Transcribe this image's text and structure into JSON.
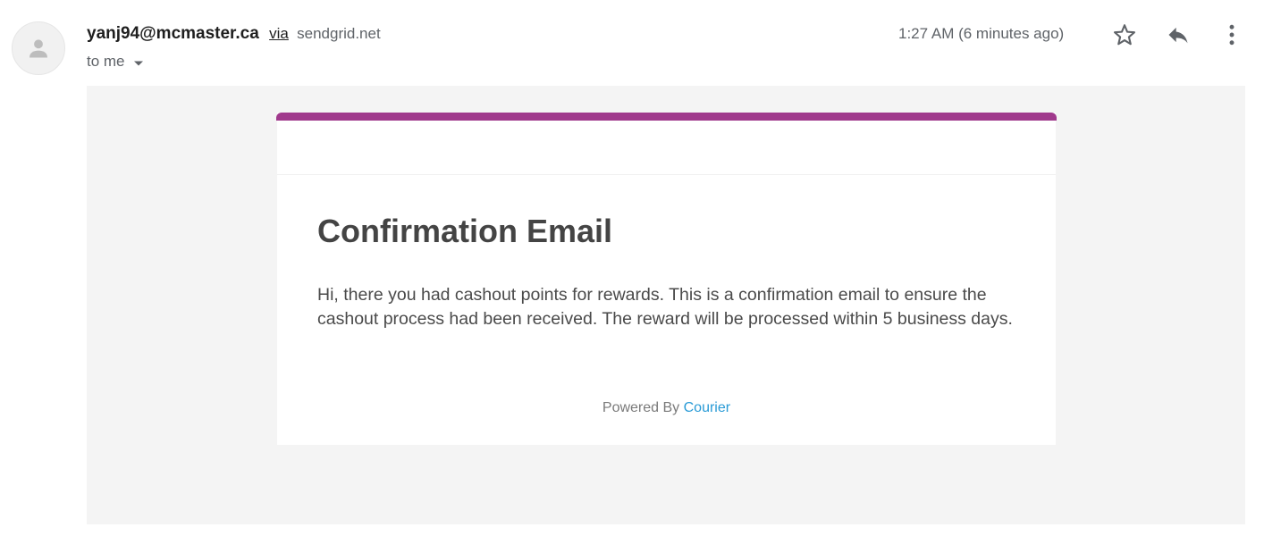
{
  "header": {
    "sender_email": "yanj94@mcmaster.ca",
    "via_label": "via",
    "via_domain": "sendgrid.net",
    "recipient_label": "to me",
    "timestamp": "1:27 AM (6 minutes ago)",
    "icons": {
      "avatar": "default-avatar-icon",
      "caret": "caret-down-icon",
      "star": "star-outline-icon",
      "reply": "reply-icon",
      "more": "more-vert-icon"
    }
  },
  "email": {
    "title": "Confirmation Email",
    "body": "Hi, there you had cashout points for rewards. This is a confirmation email to ensure the cashout process had been received. The reward will be processed within 5 business days.",
    "footer_prefix": "Powered By",
    "footer_link": "Courier"
  },
  "colors": {
    "accent_bar": "#a0398c",
    "link": "#2a9bd6",
    "body_background": "#f4f4f4"
  }
}
